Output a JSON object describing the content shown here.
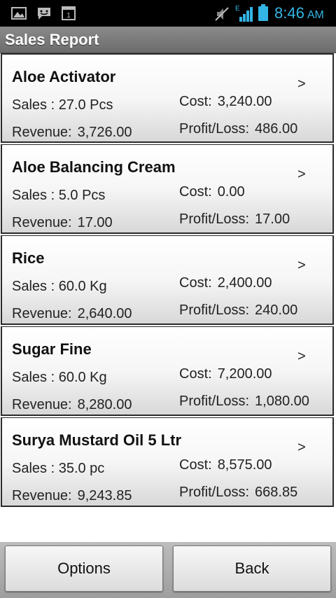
{
  "status_bar": {
    "time": "8:46",
    "ampm": "AM",
    "network": "E",
    "calendar_day": "1",
    "icons": [
      "gallery-icon",
      "message-icon",
      "calendar-icon",
      "mute-icon",
      "signal-icon",
      "battery-icon"
    ],
    "accent_color": "#33b5e5"
  },
  "header": {
    "title": "Sales Report"
  },
  "labels": {
    "sales_prefix": "Sales : ",
    "revenue": "Revenue:",
    "cost": "Cost:",
    "profit_loss": "Profit/Loss:",
    "chevron": ">"
  },
  "items": [
    {
      "name": "Aloe Activator",
      "sales": "27.0 Pcs",
      "revenue": "3,726.00",
      "cost": "3,240.00",
      "profit_loss": "486.00"
    },
    {
      "name": "Aloe Balancing Cream",
      "sales": "5.0 Pcs",
      "revenue": "17.00",
      "cost": "0.00",
      "profit_loss": "17.00"
    },
    {
      "name": "Rice",
      "sales": "60.0 Kg",
      "revenue": "2,640.00",
      "cost": "2,400.00",
      "profit_loss": "240.00"
    },
    {
      "name": "Sugar Fine",
      "sales": "60.0 Kg",
      "revenue": "8,280.00",
      "cost": "7,200.00",
      "profit_loss": "1,080.00"
    },
    {
      "name": "Surya Mustard Oil 5 Ltr",
      "sales": "35.0 pc",
      "revenue": "9,243.85",
      "cost": "8,575.00",
      "profit_loss": "668.85"
    }
  ],
  "footer": {
    "options_label": "Options",
    "back_label": "Back"
  }
}
